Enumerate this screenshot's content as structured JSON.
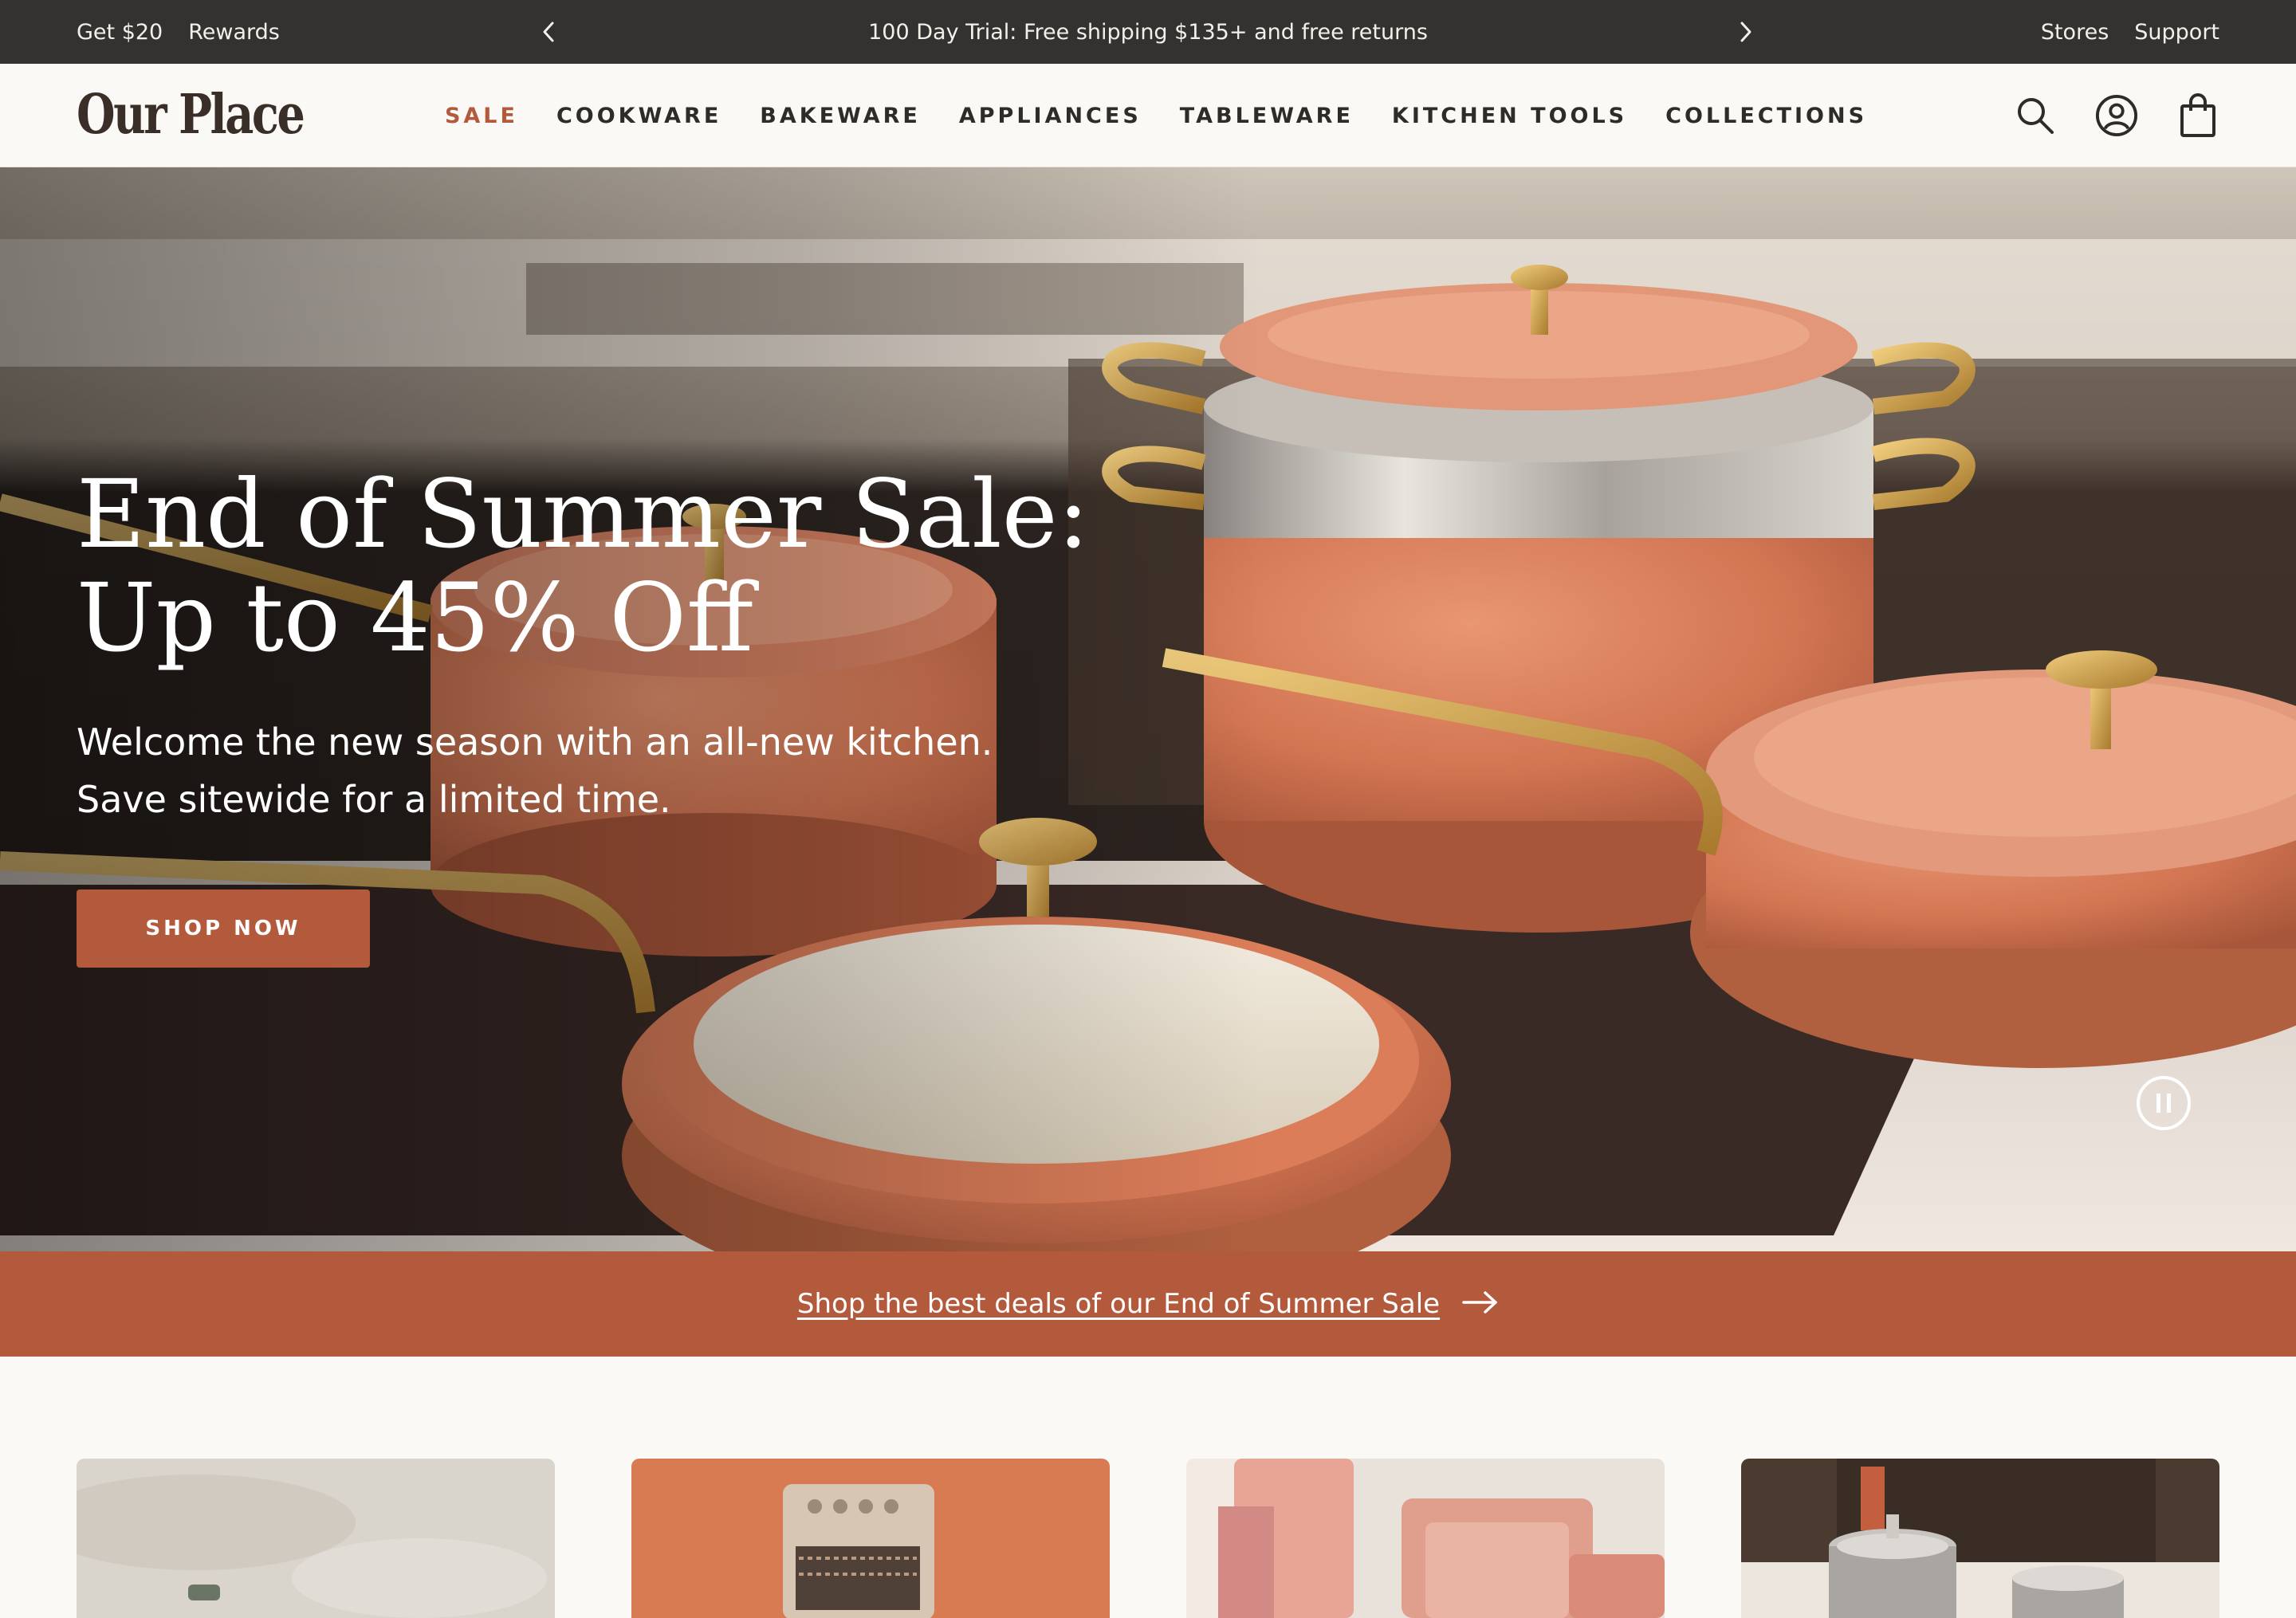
{
  "announcement": {
    "left_links": [
      "Get $20",
      "Rewards"
    ],
    "promo": "100 Day Trial: Free shipping $135+ and free returns",
    "right_links": [
      "Stores",
      "Support"
    ],
    "prev_icon": "chevron-left-icon",
    "next_icon": "chevron-right-icon"
  },
  "header": {
    "logo": "Our Place",
    "nav": [
      "SALE",
      "COOKWARE",
      "BAKEWARE",
      "APPLIANCES",
      "TABLEWARE",
      "KITCHEN TOOLS",
      "COLLECTIONS"
    ],
    "icons": [
      "search-icon",
      "account-icon",
      "cart-icon"
    ]
  },
  "hero": {
    "title_line1": "End of Summer Sale:",
    "title_line2": "Up to 45% Off",
    "subtitle": "Welcome the new season with an all-new kitchen. Save sitewide for a limited time.",
    "cta": "SHOP NOW",
    "pause_icon": "pause-icon"
  },
  "strip": {
    "link": "Shop the best deals of our End of Summer Sale",
    "icon": "arrow-right-icon"
  },
  "colors": {
    "accent": "#b45a3c",
    "topbar": "#343230",
    "background": "#fbf9f5"
  }
}
